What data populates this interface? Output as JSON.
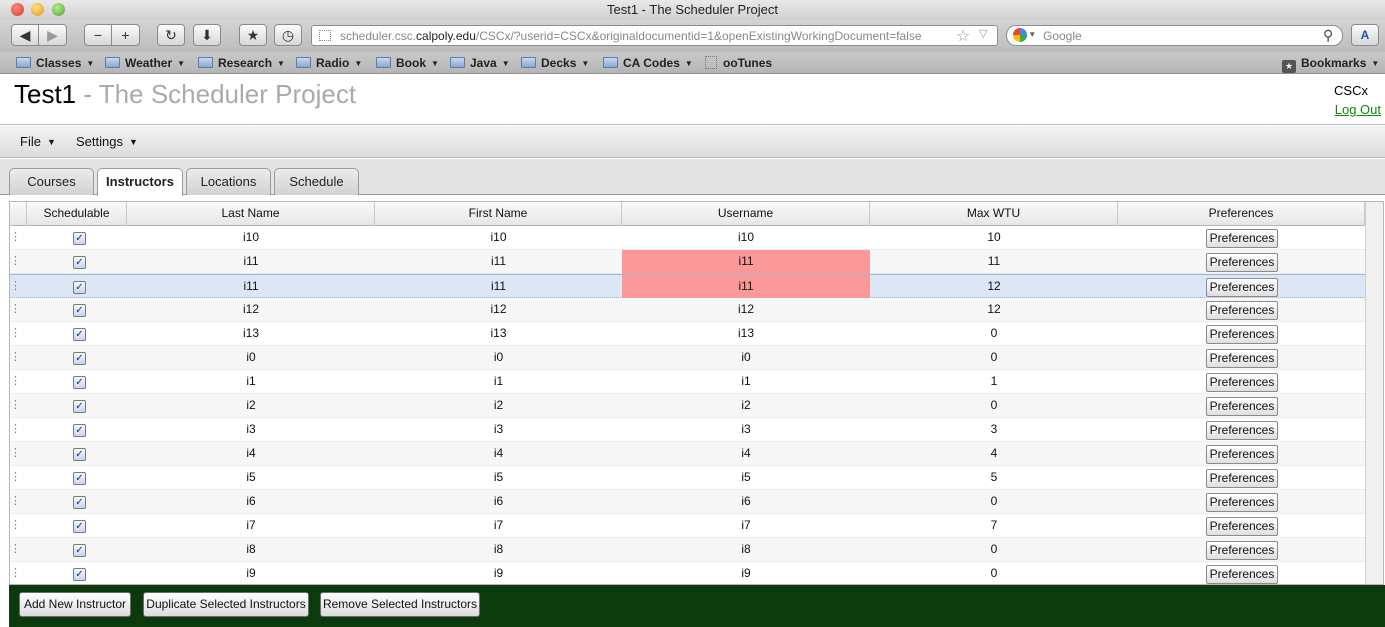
{
  "window": {
    "title": "Test1 - The Scheduler Project"
  },
  "browser": {
    "url_prefix": "scheduler.csc.",
    "url_domain": "calpoly.edu",
    "url_rest": "/CSCx/?userid=CSCx&originaldocumentid=1&openExistingWorkingDocument=false",
    "search_placeholder": "Google",
    "bookmarks": [
      "Classes",
      "Weather",
      "Research",
      "Radio",
      "Book",
      "Java",
      "Decks",
      "CA Codes",
      "ooTunes"
    ],
    "bookmarks_menu": "Bookmarks"
  },
  "header": {
    "title": "Test1",
    "subtitle": " - The Scheduler Project",
    "user": "CSCx",
    "logout": "Log Out"
  },
  "menus": {
    "file": "File",
    "settings": "Settings"
  },
  "tabs": [
    "Courses",
    "Instructors",
    "Locations",
    "Schedule"
  ],
  "active_tab": "Instructors",
  "table": {
    "columns": [
      "Schedulable",
      "Last Name",
      "First Name",
      "Username",
      "Max WTU",
      "Preferences"
    ],
    "rows": [
      {
        "last": "i10",
        "first": "i10",
        "username": "i10",
        "wtu": "10",
        "pref": "Preferences"
      },
      {
        "last": "i11",
        "first": "i11",
        "username": "i11",
        "wtu": "11",
        "pref": "Preferences"
      },
      {
        "last": "i11",
        "first": "i11",
        "username": "i11",
        "wtu": "12",
        "pref": "Preferences"
      },
      {
        "last": "i12",
        "first": "i12",
        "username": "i12",
        "wtu": "12",
        "pref": "Preferences"
      },
      {
        "last": "i13",
        "first": "i13",
        "username": "i13",
        "wtu": "0",
        "pref": "Preferences"
      },
      {
        "last": "i0",
        "first": "i0",
        "username": "i0",
        "wtu": "0",
        "pref": "Preferences"
      },
      {
        "last": "i1",
        "first": "i1",
        "username": "i1",
        "wtu": "1",
        "pref": "Preferences"
      },
      {
        "last": "i2",
        "first": "i2",
        "username": "i2",
        "wtu": "0",
        "pref": "Preferences"
      },
      {
        "last": "i3",
        "first": "i3",
        "username": "i3",
        "wtu": "3",
        "pref": "Preferences"
      },
      {
        "last": "i4",
        "first": "i4",
        "username": "i4",
        "wtu": "4",
        "pref": "Preferences"
      },
      {
        "last": "i5",
        "first": "i5",
        "username": "i5",
        "wtu": "5",
        "pref": "Preferences"
      },
      {
        "last": "i6",
        "first": "i6",
        "username": "i6",
        "wtu": "0",
        "pref": "Preferences"
      },
      {
        "last": "i7",
        "first": "i7",
        "username": "i7",
        "wtu": "7",
        "pref": "Preferences"
      },
      {
        "last": "i8",
        "first": "i8",
        "username": "i8",
        "wtu": "0",
        "pref": "Preferences"
      },
      {
        "last": "i9",
        "first": "i9",
        "username": "i9",
        "wtu": "0",
        "pref": "Preferences"
      }
    ]
  },
  "footer": {
    "add": "Add New Instructor",
    "duplicate": "Duplicate Selected Instructors",
    "remove": "Remove Selected Instructors"
  },
  "colors": {
    "conflict": "#fb9898",
    "selected_row": "#dbe6f6",
    "footer_bg": "#0d3a0d",
    "logout_link": "#0a8a0a"
  }
}
